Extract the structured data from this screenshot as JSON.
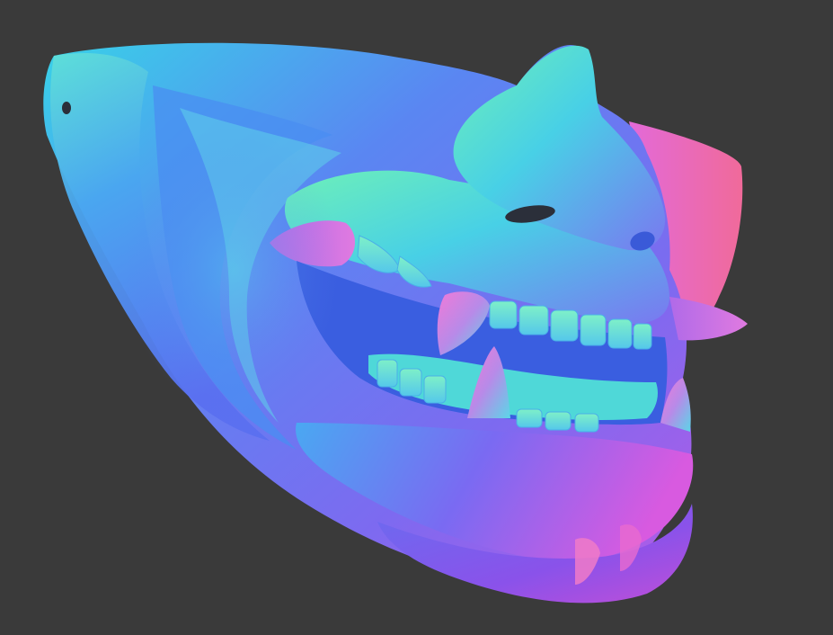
{
  "scene": {
    "background_color": "#3a3a3a",
    "subject": "mask-model",
    "shading": "normal-map",
    "palette": {
      "blue": "#5a7cf0",
      "cyan": "#38d6e6",
      "teal": "#3fe0c4",
      "green": "#6ef0a8",
      "magenta": "#d35be6",
      "purple": "#8a56f0",
      "pink": "#f06ad9"
    }
  }
}
